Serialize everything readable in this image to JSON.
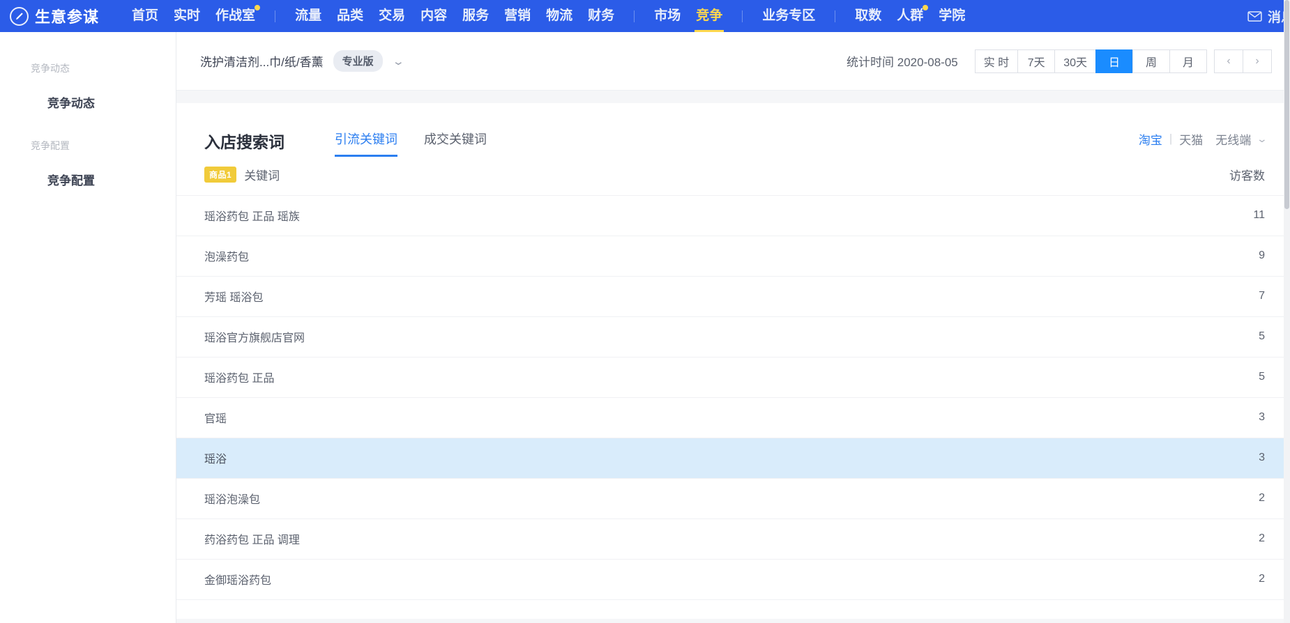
{
  "topnav": {
    "brand": "生意参谋",
    "logo_icon": "pen-circle-icon",
    "groups": [
      {
        "items": [
          {
            "label": "首页",
            "active": false
          },
          {
            "label": "实时",
            "active": false
          },
          {
            "label": "作战室",
            "active": false,
            "badge_dot": true
          }
        ]
      },
      {
        "items": [
          {
            "label": "流量",
            "active": false
          },
          {
            "label": "品类",
            "active": false
          },
          {
            "label": "交易",
            "active": false
          },
          {
            "label": "内容",
            "active": false
          },
          {
            "label": "服务",
            "active": false
          },
          {
            "label": "营销",
            "active": false
          },
          {
            "label": "物流",
            "active": false
          },
          {
            "label": "财务",
            "active": false
          }
        ]
      },
      {
        "items": [
          {
            "label": "市场",
            "active": false
          },
          {
            "label": "竞争",
            "active": true
          }
        ]
      },
      {
        "items": [
          {
            "label": "业务专区",
            "active": false
          }
        ]
      },
      {
        "items": [
          {
            "label": "取数",
            "active": false
          },
          {
            "label": "人群",
            "active": false,
            "badge_dot": true
          },
          {
            "label": "学院",
            "active": false
          }
        ]
      }
    ],
    "right": {
      "mail_icon": "envelope-icon",
      "label": "消息"
    }
  },
  "sidebar": {
    "sections": [
      {
        "group": "竞争动态",
        "items": [
          {
            "label": "竞争动态"
          }
        ]
      },
      {
        "group": "竞争配置",
        "items": [
          {
            "label": "竞争配置"
          }
        ]
      }
    ]
  },
  "filterbar": {
    "category": "洗护清洁剂...巾/纸/香薰",
    "pro_badge": "专业版",
    "category_chevron_icon": "chevron-down-icon",
    "stat_time": "统计时间 2020-08-05",
    "range_buttons": [
      {
        "label": "实 时",
        "active": false
      },
      {
        "label": "7天",
        "active": false
      },
      {
        "label": "30天",
        "active": false
      },
      {
        "label": "日",
        "active": true
      },
      {
        "label": "周",
        "active": false
      },
      {
        "label": "月",
        "active": false
      }
    ],
    "prev_icon": "chevron-left-icon",
    "next_icon": "chevron-right-icon"
  },
  "card": {
    "title": "入店搜索词",
    "tabs": [
      {
        "label": "引流关键词",
        "active": true
      },
      {
        "label": "成交关键词",
        "active": false
      }
    ],
    "channels": [
      {
        "label": "淘宝",
        "active": true
      },
      {
        "label": "天猫",
        "active": false
      }
    ],
    "channel_divider": "|",
    "terminal": "无线端",
    "terminal_chevron_icon": "chevron-down-icon",
    "table": {
      "headers": {
        "badge": "商品1",
        "keyword": "关键词",
        "visitors": "访客数"
      },
      "rows": [
        {
          "keyword": "瑶浴药包 正品 瑶族",
          "visitors": "11",
          "highlight": false
        },
        {
          "keyword": "泡澡药包",
          "visitors": "9",
          "highlight": false
        },
        {
          "keyword": "芳瑶 瑶浴包",
          "visitors": "7",
          "highlight": false
        },
        {
          "keyword": "瑶浴官方旗舰店官网",
          "visitors": "5",
          "highlight": false
        },
        {
          "keyword": "瑶浴药包 正品",
          "visitors": "5",
          "highlight": false
        },
        {
          "keyword": "官瑶",
          "visitors": "3",
          "highlight": false
        },
        {
          "keyword": "瑶浴",
          "visitors": "3",
          "highlight": true
        },
        {
          "keyword": "瑶浴泡澡包",
          "visitors": "2",
          "highlight": false
        },
        {
          "keyword": "药浴药包 正品 调理",
          "visitors": "2",
          "highlight": false
        },
        {
          "keyword": "金御瑶浴药包",
          "visitors": "2",
          "highlight": false
        }
      ]
    }
  },
  "colors": {
    "nav_blue": "#2b5ce8",
    "accent_yellow": "#ffd84d",
    "active_blue": "#1a8cff",
    "link_blue": "#2b7ef0",
    "row_highlight": "#d9ecfb",
    "badge_yellow": "#f1cb3a"
  }
}
